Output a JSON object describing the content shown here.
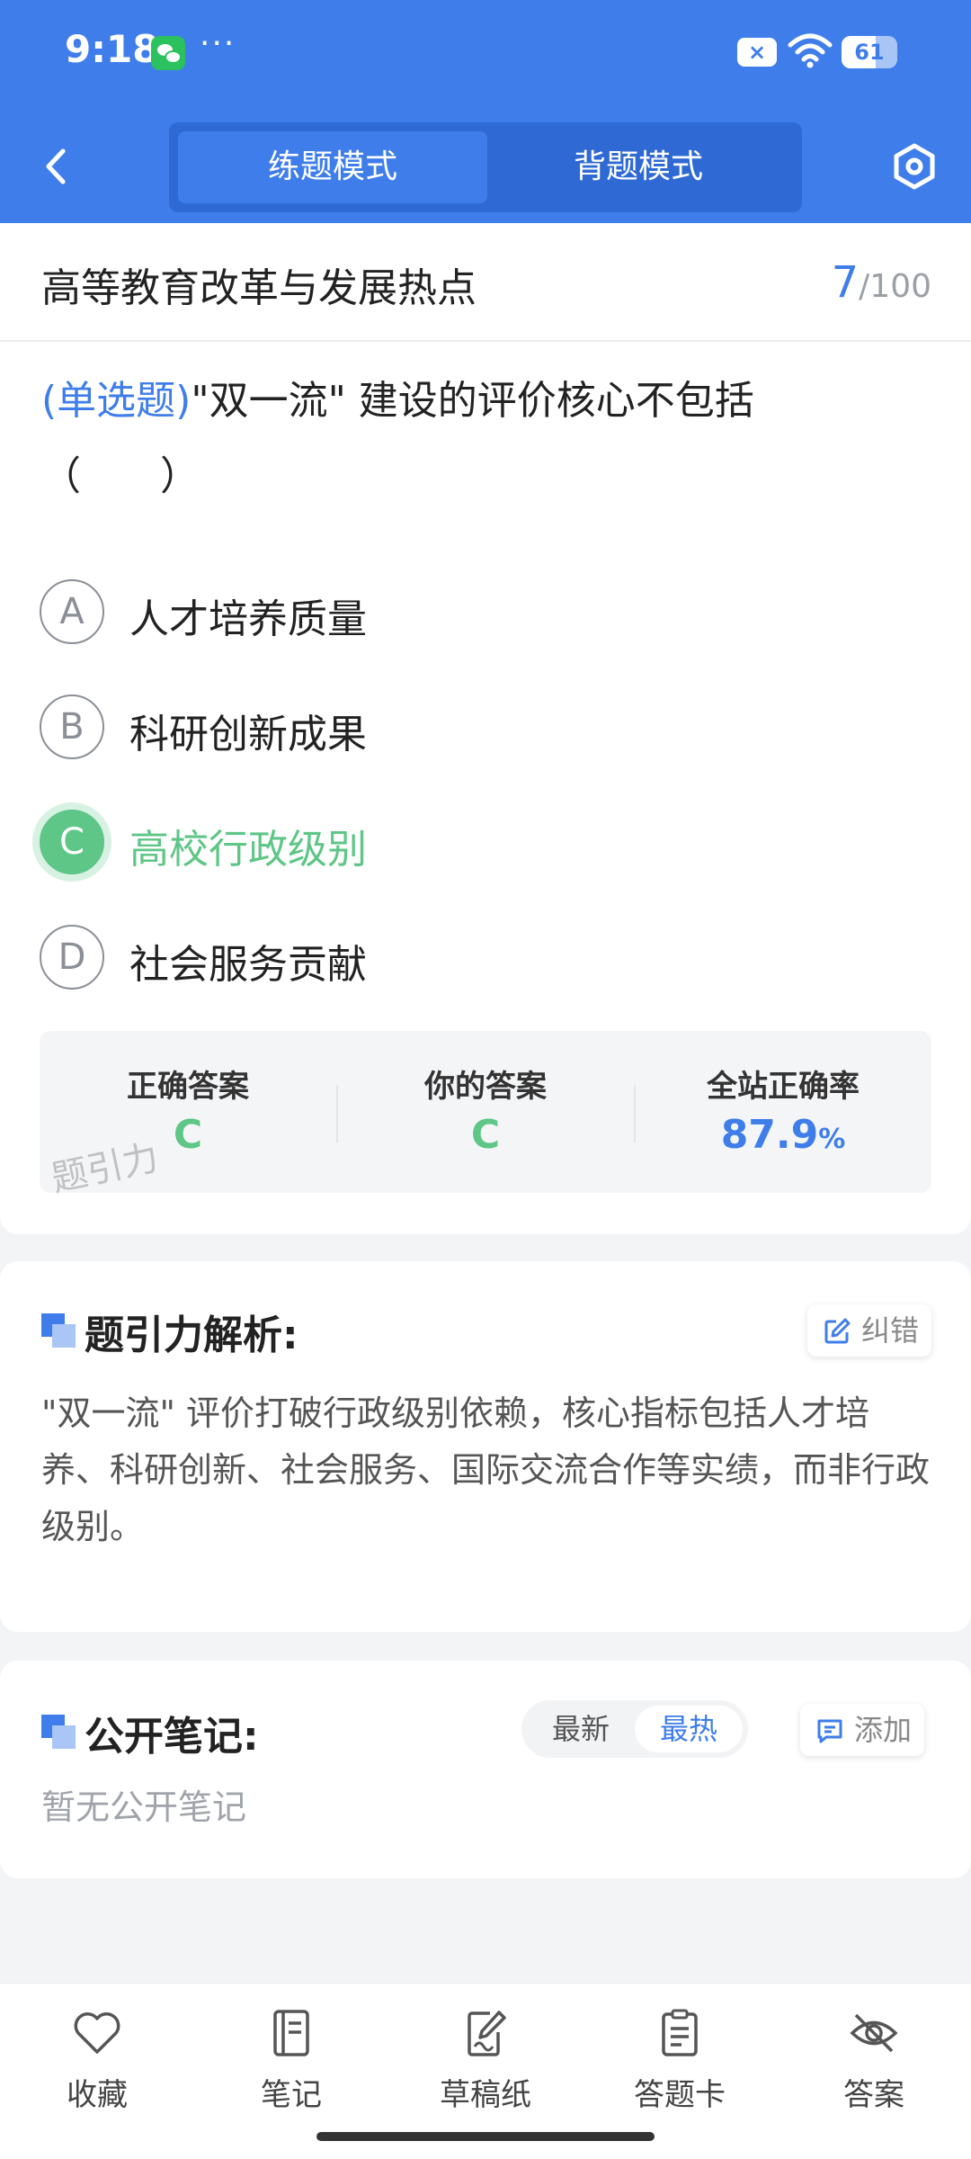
{
  "status_bar": {
    "time": "9:18",
    "more": "···",
    "close_badge": "×",
    "battery_level": "61",
    "battery_fraction": 0.61,
    "icons": [
      "wechat-icon",
      "wifi-icon",
      "battery-icon"
    ]
  },
  "header": {
    "modes": [
      {
        "label": "练题模式",
        "active": true
      },
      {
        "label": "背题模式",
        "active": false
      }
    ],
    "icons": [
      "back-icon",
      "settings-icon"
    ]
  },
  "topic": {
    "title": "高等教育改革与发展热点",
    "current": "7",
    "total": "/100"
  },
  "question": {
    "type": "(单选题)",
    "text": "\"双一流\" 建设的评价核心不包括",
    "blank": "（　　）"
  },
  "options": [
    {
      "letter": "A",
      "text": "人才培养质量"
    },
    {
      "letter": "B",
      "text": "科研创新成果"
    },
    {
      "letter": "C",
      "text": "高校行政级别",
      "selected_correct": true
    },
    {
      "letter": "D",
      "text": "社会服务贡献"
    }
  ],
  "stats": {
    "correct_label": "正确答案",
    "correct_value": "C",
    "yours_label": "你的答案",
    "yours_value": "C",
    "rate_label": "全站正确率",
    "rate_value": "87.9",
    "rate_unit": "%",
    "watermark": "题引力"
  },
  "analysis": {
    "title": "题引力解析:",
    "report_label": "纠错",
    "text": "\"双一流\" 评价打破行政级别依赖，核心指标包括人才培养、科研创新、社会服务、国际交流合作等实绩，而非行政级别。"
  },
  "notes": {
    "title": "公开笔记:",
    "sort_latest": "最新",
    "sort_hot": "最热",
    "add_label": "添加",
    "empty": "暂无公开笔记"
  },
  "toolbar": [
    {
      "label": "收藏",
      "icon": "heart-icon"
    },
    {
      "label": "笔记",
      "icon": "notebook-icon"
    },
    {
      "label": "草稿纸",
      "icon": "draft-icon"
    },
    {
      "label": "答题卡",
      "icon": "answer-card-icon"
    },
    {
      "label": "答案",
      "icon": "eye-off-icon"
    }
  ],
  "colors": {
    "primary": "#3f7eea",
    "correct": "#5ec686",
    "background": "#f3f4f6"
  }
}
